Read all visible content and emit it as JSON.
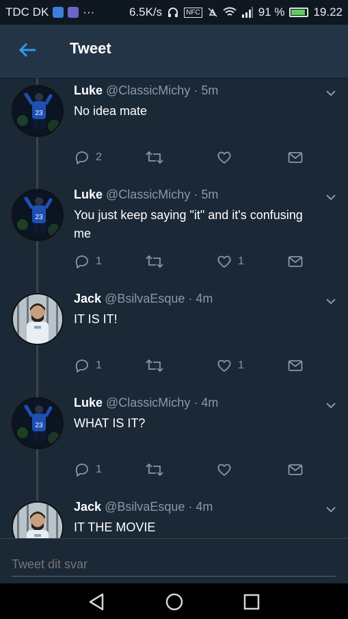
{
  "status_bar": {
    "carrier": "TDC DK",
    "more": "···",
    "speed": "6.5K/s",
    "nfc": "NFC",
    "battery_percent": "91 %",
    "battery_level": 0.91,
    "time": "19.22"
  },
  "header": {
    "title": "Tweet"
  },
  "tweets": [
    {
      "name": "Luke",
      "handle": "@ClassicMichy",
      "time": "· 5m",
      "text": "No idea mate",
      "avatar": "luke",
      "reply_count": "2",
      "like_count": ""
    },
    {
      "name": "Luke",
      "handle": "@ClassicMichy",
      "time": "· 5m",
      "text": "You just keep saying \"it\" and it's confusing me",
      "avatar": "luke",
      "reply_count": "1",
      "like_count": "1"
    },
    {
      "name": "Jack⁣",
      "handle": "@BsilvaEsque",
      "time": "· 4m",
      "text": "IT IS IT!",
      "avatar": "jack",
      "reply_count": "1",
      "like_count": "1"
    },
    {
      "name": "Luke",
      "handle": "@ClassicMichy",
      "time": "· 4m",
      "text": "WHAT IS IT?",
      "avatar": "luke",
      "reply_count": "1",
      "like_count": ""
    },
    {
      "name": "Jack⁣",
      "handle": "@BsilvaEsque",
      "time": "· 4m",
      "text": "IT THE MOVIE",
      "avatar": "jack",
      "reply_count": "",
      "like_count": ""
    }
  ],
  "reply": {
    "placeholder": "Tweet dit svar"
  },
  "colors": {
    "accent": "#2c9de6",
    "background": "#1b2836",
    "header": "#243447",
    "muted": "#8899a6"
  }
}
